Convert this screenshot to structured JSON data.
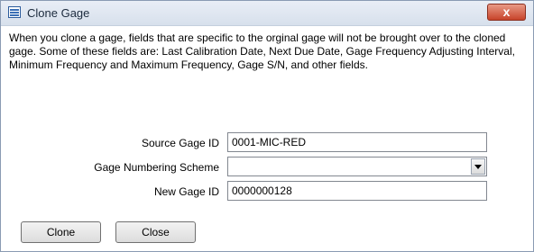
{
  "window": {
    "title": "Clone Gage",
    "close_symbol": "x"
  },
  "description": "When you clone a gage, fields that are specific to the orginal gage will not be brought over to the cloned gage. Some of these fields are: Last Calibration Date, Next Due Date, Gage Frequency Adjusting Interval, Minimum Frequency and Maximum Frequency, Gage S/N, and other fields.",
  "form": {
    "source_gage_id": {
      "label": "Source Gage ID",
      "value": "0001-MIC-RED"
    },
    "gage_numbering_scheme": {
      "label": "Gage Numbering Scheme",
      "value": ""
    },
    "new_gage_id": {
      "label": "New Gage ID",
      "value": "0000000128"
    }
  },
  "buttons": {
    "clone": "Clone",
    "close": "Close"
  },
  "icons": {
    "app": "form-window-icon",
    "close": "close-icon",
    "dropdown": "chevron-down-icon"
  },
  "colors": {
    "title_bar": "#dbe3ee",
    "close_button": "#c7432a",
    "field_border": "#828790"
  }
}
